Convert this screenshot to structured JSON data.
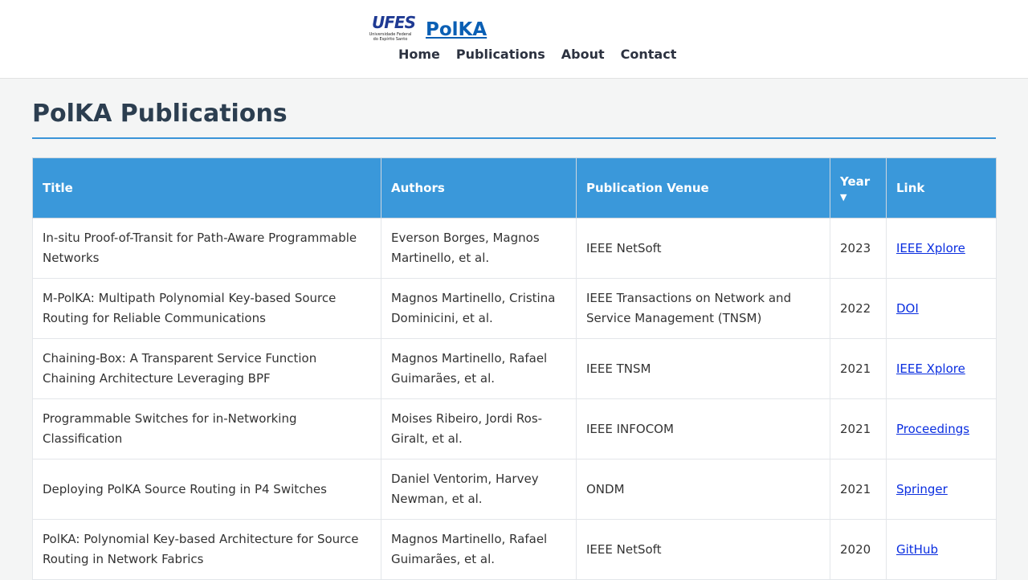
{
  "header": {
    "logo_text": "UFES",
    "logo_sub": "Universidade Federal do Espírito Santo",
    "site_title": "PolKA",
    "nav": [
      "Home",
      "Publications",
      "About",
      "Contact"
    ]
  },
  "page": {
    "title": "PolKA Publications"
  },
  "table": {
    "columns": [
      "Title",
      "Authors",
      "Publication Venue",
      "Year",
      "Link"
    ],
    "sort_indicator": "▼",
    "rows": [
      {
        "title": "In-situ Proof-of-Transit for Path-Aware Programmable Networks",
        "authors": "Everson Borges, Magnos Martinello, et al.",
        "venue": "IEEE NetSoft",
        "year": "2023",
        "link": "IEEE Xplore"
      },
      {
        "title": "M-PolKA: Multipath Polynomial Key-based Source Routing for Reliable Communications",
        "authors": "Magnos Martinello, Cristina Dominicini, et al.",
        "venue": "IEEE Transactions on Network and Service Management (TNSM)",
        "year": "2022",
        "link": "DOI"
      },
      {
        "title": "Chaining-Box: A Transparent Service Function Chaining Architecture Leveraging BPF",
        "authors": "Magnos Martinello, Rafael Guimarães, et al.",
        "venue": "IEEE TNSM",
        "year": "2021",
        "link": "IEEE Xplore"
      },
      {
        "title": "Programmable Switches for in-Networking Classification",
        "authors": "Moises Ribeiro, Jordi Ros-Giralt, et al.",
        "venue": "IEEE INFOCOM",
        "year": "2021",
        "link": "Proceedings"
      },
      {
        "title": "Deploying PolKA Source Routing in P4 Switches",
        "authors": "Daniel Ventorim, Harvey Newman, et al.",
        "venue": "ONDM",
        "year": "2021",
        "link": "Springer"
      },
      {
        "title": "PolKA: Polynomial Key-based Architecture for Source Routing in Network Fabrics",
        "authors": "Magnos Martinello, Rafael Guimarães, et al.",
        "venue": "IEEE NetSoft",
        "year": "2020",
        "link": "GitHub"
      }
    ]
  }
}
